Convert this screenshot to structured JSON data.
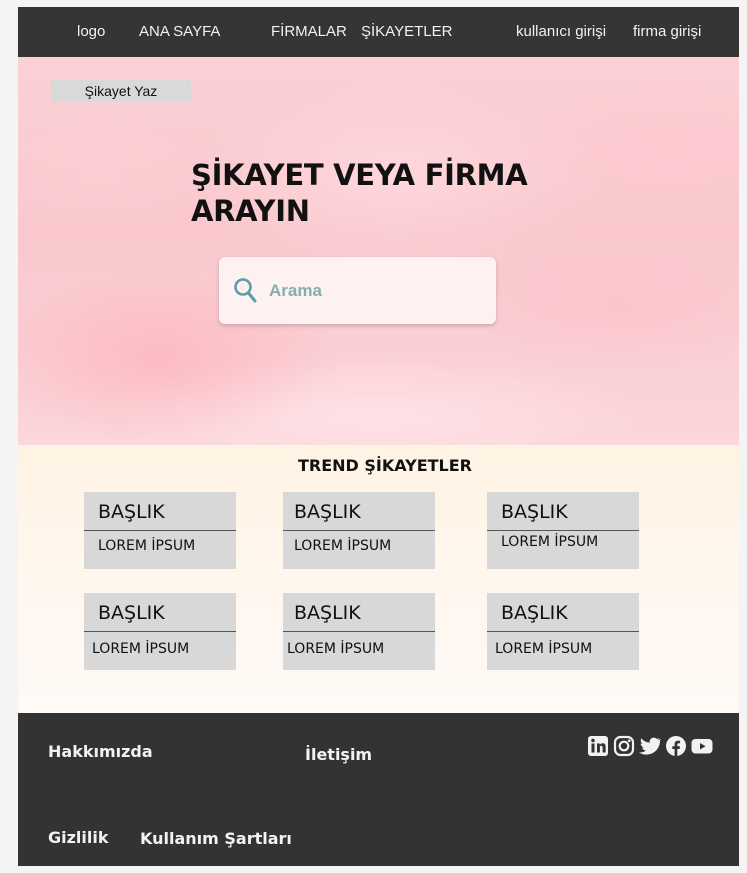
{
  "nav": {
    "logo": "logo",
    "home": "ANA SAYFA",
    "companies": "FİRMALAR",
    "complaints": "ŞİKAYETLER",
    "user_login": "kullanıcı girişi",
    "company_login": "firma girişi"
  },
  "hero": {
    "write_button": "Şikayet Yaz",
    "title": "ŞİKAYET VEYA FİRMA ARAYIN",
    "search_placeholder": "Arama"
  },
  "trend": {
    "title": "TREND ŞİKAYETLER",
    "cards": [
      {
        "title": "BAŞLIK",
        "body": "LOREM İPSUM"
      },
      {
        "title": "BAŞLIK",
        "body": "LOREM İPSUM"
      },
      {
        "title": "BAŞLIK",
        "body": "LOREM İPSUM"
      },
      {
        "title": "BAŞLIK",
        "body": "LOREM İPSUM"
      },
      {
        "title": "BAŞLIK",
        "body": "LOREM İPSUM"
      },
      {
        "title": "BAŞLIK",
        "body": "LOREM İPSUM"
      }
    ]
  },
  "footer": {
    "about": "Hakkımızda",
    "contact": "İletişim",
    "privacy": "Gizlilik",
    "terms": "Kullanım Şartları",
    "social_icons": [
      "linkedin-icon",
      "instagram-icon",
      "twitter-icon",
      "facebook-icon",
      "youtube-icon"
    ]
  }
}
